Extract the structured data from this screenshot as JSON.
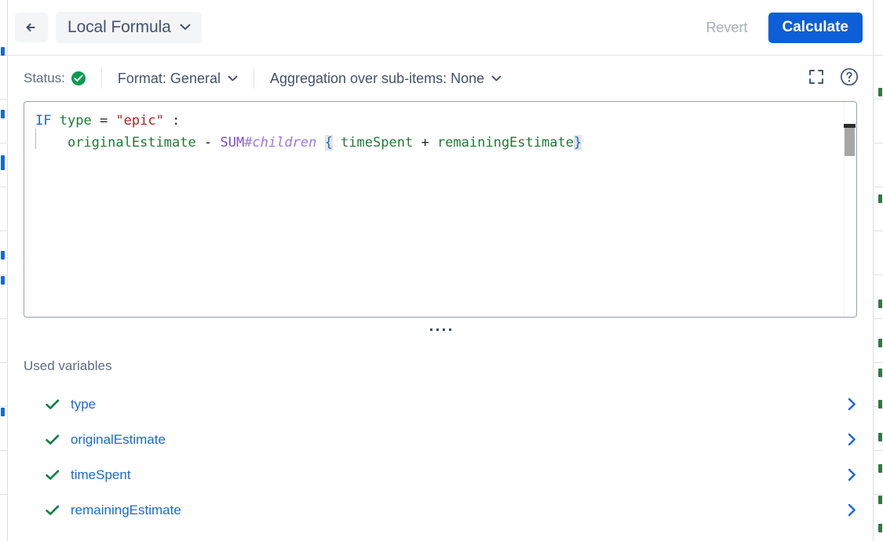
{
  "header": {
    "back_icon": "arrow-left-icon",
    "title": "Local Formula",
    "title_chevron_icon": "chevron-down-icon",
    "revert_label": "Revert",
    "calculate_label": "Calculate",
    "calculate_color": "#0c5fd6"
  },
  "toolbar": {
    "status_label": "Status:",
    "status_icon": "check-circle-icon",
    "status_color": "#0c9a52",
    "format_label": "Format: General",
    "format_chevron_icon": "chevron-down-icon",
    "aggregation_label": "Aggregation over sub-items: None",
    "aggregation_chevron_icon": "chevron-down-icon",
    "expand_icon": "expand-fullscreen-icon",
    "help_icon": "question-circle-icon"
  },
  "editor": {
    "line1": {
      "kw": "IF",
      "var": "type",
      "op_eq": "=",
      "str": "\"epic\"",
      "colon": ":"
    },
    "line2": {
      "var1": "originalEstimate",
      "op_minus": "-",
      "fn": "SUM",
      "hash": "#children",
      "brace_open": "{",
      "var2": "timeSpent",
      "op_plus": "+",
      "var3": "remainingEstimate",
      "brace_close": "}"
    },
    "colors": {
      "keyword": "#1868db",
      "variable": "#1f7a35",
      "string": "#b02121",
      "function": "#7a4fd6",
      "qualifier": "#9a78e8",
      "brace": "#1868db"
    }
  },
  "resize_grip": "resize-handle-dots",
  "used_variables": {
    "title": "Used variables",
    "items": [
      {
        "name": "type",
        "status_icon": "check-icon",
        "chevron_icon": "chevron-right-icon"
      },
      {
        "name": "originalEstimate",
        "status_icon": "check-icon",
        "chevron_icon": "chevron-right-icon"
      },
      {
        "name": "timeSpent",
        "status_icon": "check-icon",
        "chevron_icon": "chevron-right-icon"
      },
      {
        "name": "remainingEstimate",
        "status_icon": "check-icon",
        "chevron_icon": "chevron-right-icon"
      }
    ]
  }
}
